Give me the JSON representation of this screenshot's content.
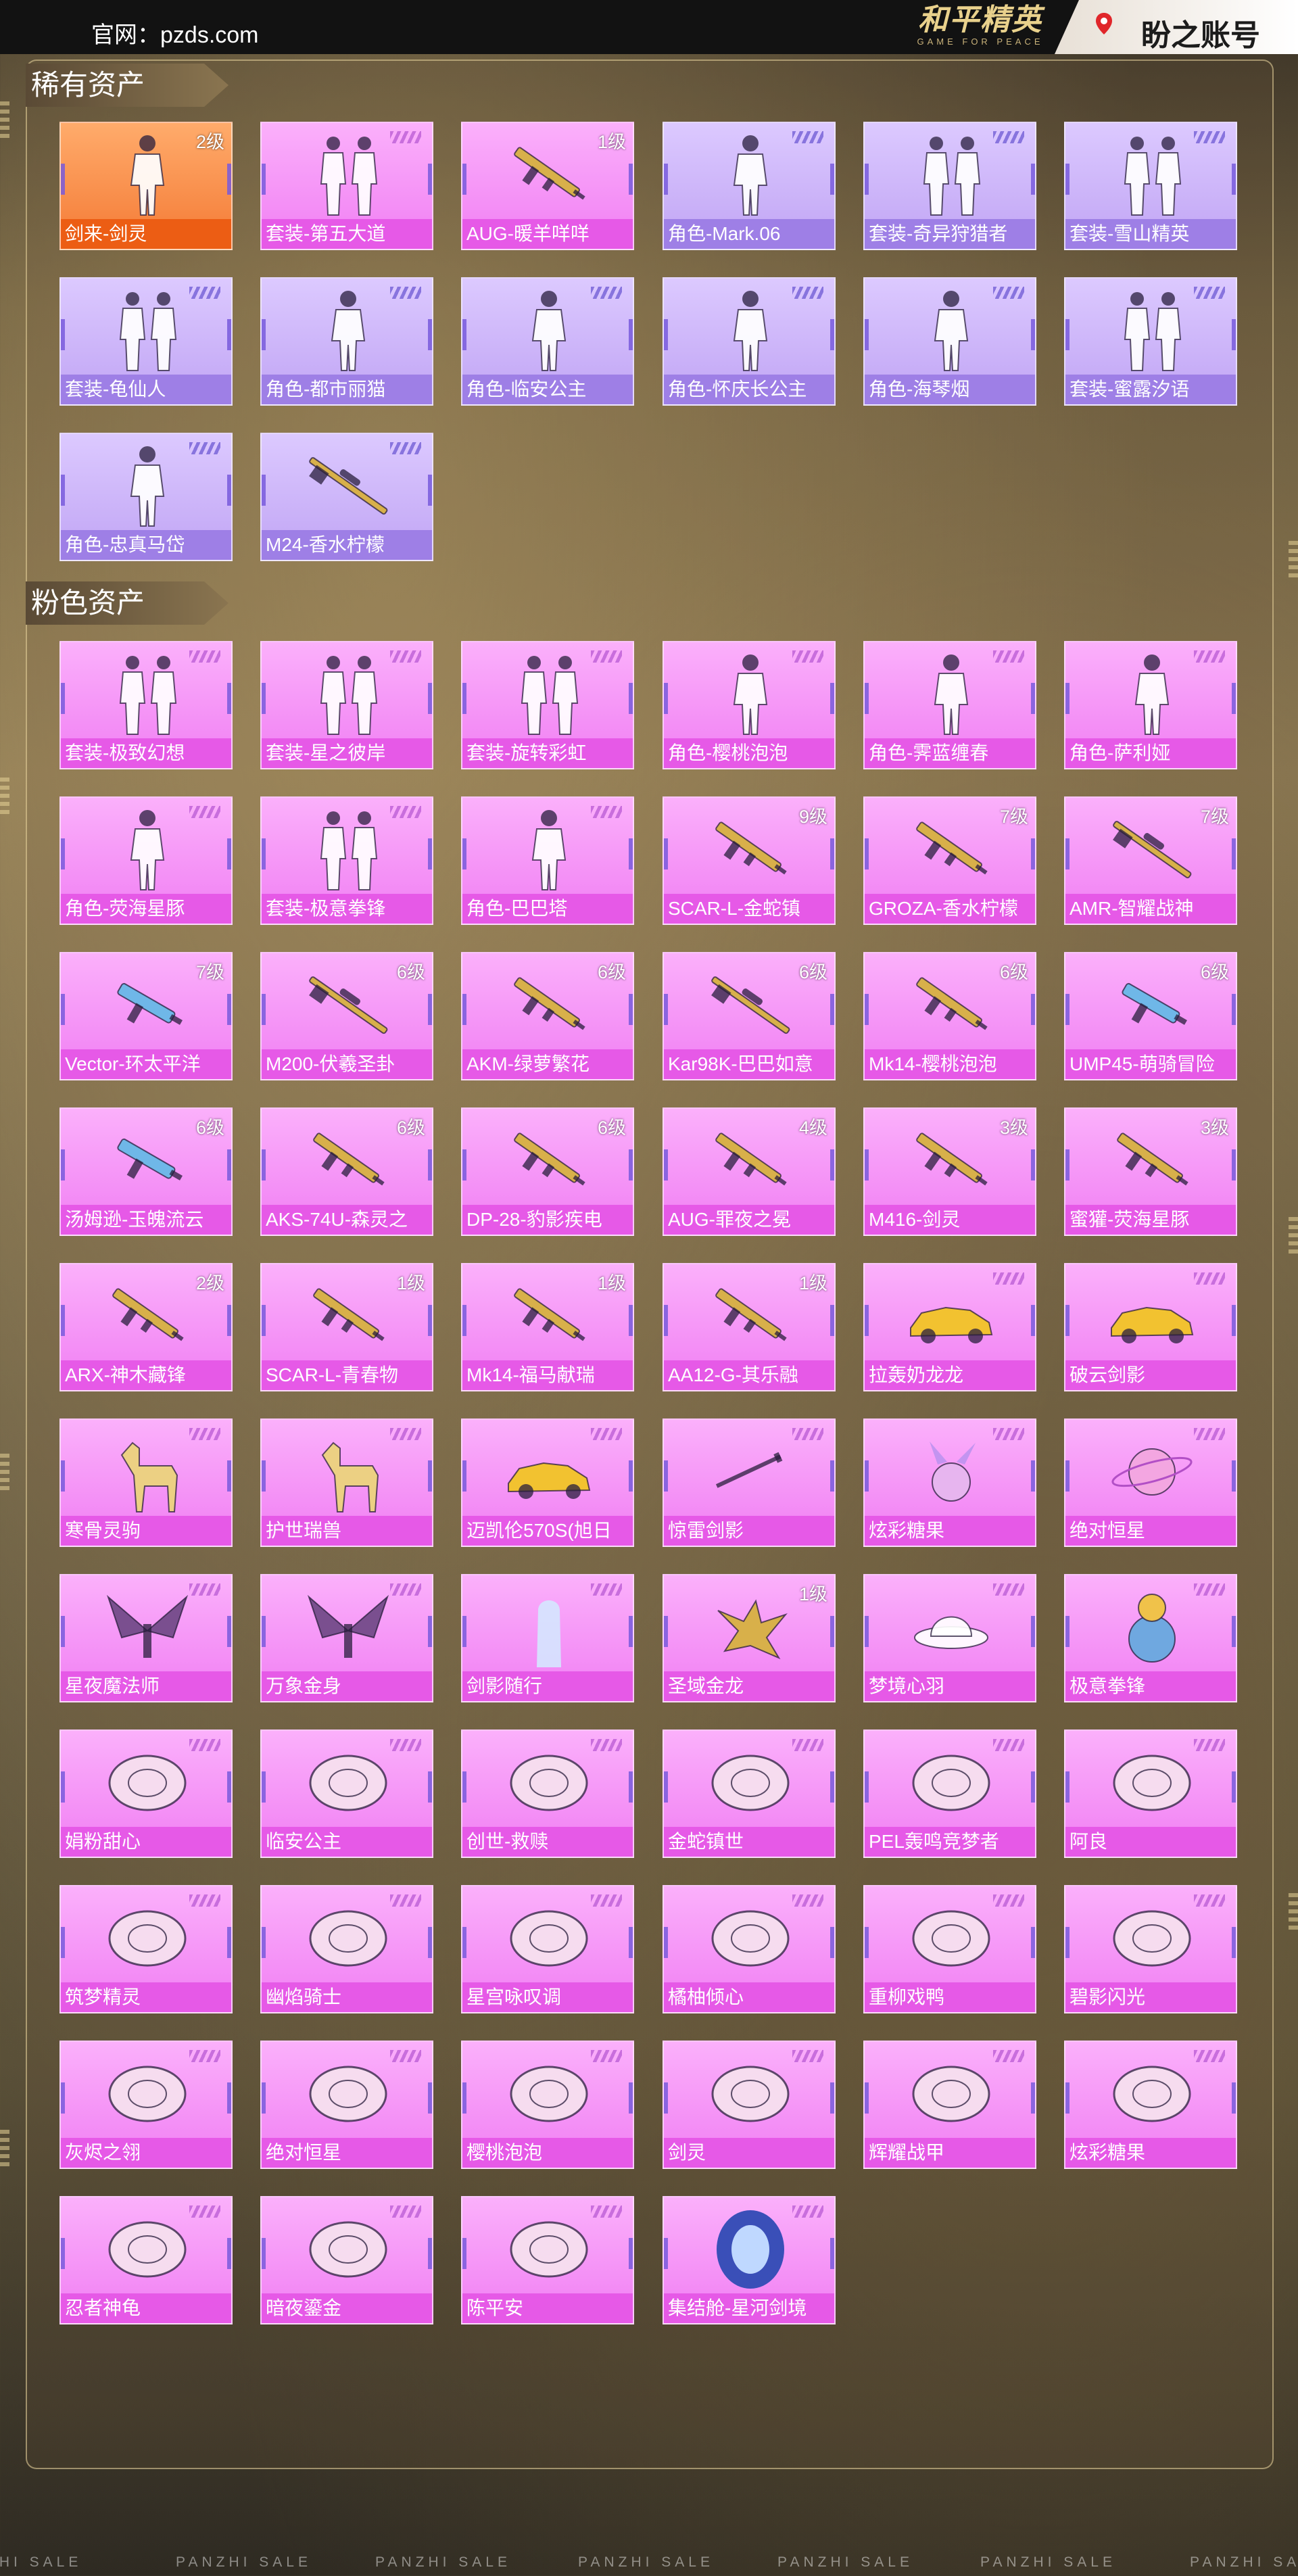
{
  "header": {
    "site_label": "官网：pzds.com",
    "game_logo_title": "和平精英",
    "game_logo_subtitle": "GAME FOR PEACE",
    "brand": "盼之账号"
  },
  "sections": [
    {
      "title": "稀有资产",
      "items": [
        {
          "label": "剑来-剑灵",
          "level": "2级",
          "style": "rare-orange",
          "icon": "character-figure-icon"
        },
        {
          "label": "套装-第五大道",
          "level": "",
          "style": "pink",
          "icon": "outfit-pair-icon"
        },
        {
          "label": "AUG-暖羊咩咩",
          "level": "1级",
          "style": "pink",
          "icon": "rifle-icon"
        },
        {
          "label": "角色-Mark.06",
          "level": "",
          "style": "rare-purple",
          "icon": "character-figure-icon"
        },
        {
          "label": "套装-奇异狩猎者",
          "level": "",
          "style": "rare-purple",
          "icon": "outfit-pair-icon"
        },
        {
          "label": "套装-雪山精英",
          "level": "",
          "style": "rare-purple",
          "icon": "outfit-pair-icon"
        },
        {
          "label": "套装-龟仙人",
          "level": "",
          "style": "rare-purple",
          "icon": "outfit-pair-icon"
        },
        {
          "label": "角色-都市丽猫",
          "level": "",
          "style": "rare-purple",
          "icon": "character-figure-icon"
        },
        {
          "label": "角色-临安公主",
          "level": "",
          "style": "rare-purple",
          "icon": "character-figure-icon"
        },
        {
          "label": "角色-怀庆长公主",
          "level": "",
          "style": "rare-purple",
          "icon": "character-figure-icon"
        },
        {
          "label": "角色-海琴烟",
          "level": "",
          "style": "rare-purple",
          "icon": "character-figure-icon"
        },
        {
          "label": "套装-蜜露汐语",
          "level": "",
          "style": "rare-purple",
          "icon": "outfit-pair-icon"
        },
        {
          "label": "角色-忠真马岱",
          "level": "",
          "style": "rare-purple",
          "icon": "character-figure-icon"
        },
        {
          "label": "M24-香水柠檬",
          "level": "",
          "style": "rare-purple",
          "icon": "sniper-rifle-icon"
        }
      ]
    },
    {
      "title": "粉色资产",
      "items": [
        {
          "label": "套装-极致幻想",
          "level": "",
          "style": "pink",
          "icon": "outfit-pair-icon"
        },
        {
          "label": "套装-星之彼岸",
          "level": "",
          "style": "pink",
          "icon": "outfit-pair-icon"
        },
        {
          "label": "套装-旋转彩虹",
          "level": "",
          "style": "pink",
          "icon": "outfit-pair-icon"
        },
        {
          "label": "角色-樱桃泡泡",
          "level": "",
          "style": "pink",
          "icon": "character-figure-icon"
        },
        {
          "label": "角色-霁蓝缠春",
          "level": "",
          "style": "pink",
          "icon": "character-figure-icon"
        },
        {
          "label": "角色-萨利娅",
          "level": "",
          "style": "pink",
          "icon": "character-figure-icon"
        },
        {
          "label": "角色-荧海星豚",
          "level": "",
          "style": "pink",
          "icon": "character-figure-icon"
        },
        {
          "label": "套装-极意拳锋",
          "level": "",
          "style": "pink",
          "icon": "outfit-pair-icon"
        },
        {
          "label": "角色-巴巴塔",
          "level": "",
          "style": "pink",
          "icon": "character-figure-icon"
        },
        {
          "label": "SCAR-L-金蛇镇",
          "level": "9级",
          "style": "pink",
          "icon": "rifle-icon"
        },
        {
          "label": "GROZA-香水柠檬",
          "level": "7级",
          "style": "pink",
          "icon": "rifle-icon"
        },
        {
          "label": "AMR-智耀战神",
          "level": "7级",
          "style": "pink",
          "icon": "sniper-rifle-icon"
        },
        {
          "label": "Vector-环太平洋",
          "level": "7级",
          "style": "pink",
          "icon": "smg-icon"
        },
        {
          "label": "M200-伏羲圣卦",
          "level": "6级",
          "style": "pink",
          "icon": "sniper-rifle-icon"
        },
        {
          "label": "AKM-绿萝繁花",
          "level": "6级",
          "style": "pink",
          "icon": "rifle-icon"
        },
        {
          "label": "Kar98K-巴巴如意",
          "level": "6级",
          "style": "pink",
          "icon": "sniper-rifle-icon"
        },
        {
          "label": "Mk14-樱桃泡泡",
          "level": "6级",
          "style": "pink",
          "icon": "rifle-icon"
        },
        {
          "label": "UMP45-萌骑冒险",
          "level": "6级",
          "style": "pink",
          "icon": "smg-icon"
        },
        {
          "label": "汤姆逊-玉魄流云",
          "level": "6级",
          "style": "pink",
          "icon": "smg-icon"
        },
        {
          "label": "AKS-74U-森灵之",
          "level": "6级",
          "style": "pink",
          "icon": "rifle-icon"
        },
        {
          "label": "DP-28-豹影疾电",
          "level": "6级",
          "style": "pink",
          "icon": "rifle-icon"
        },
        {
          "label": "AUG-罪夜之冕",
          "level": "4级",
          "style": "pink",
          "icon": "rifle-icon"
        },
        {
          "label": "M416-剑灵",
          "level": "3级",
          "style": "pink",
          "icon": "rifle-icon"
        },
        {
          "label": "蜜獾-荧海星豚",
          "level": "3级",
          "style": "pink",
          "icon": "rifle-icon"
        },
        {
          "label": "ARX-神木藏锋",
          "level": "2级",
          "style": "pink",
          "icon": "rifle-icon"
        },
        {
          "label": "SCAR-L-青春物",
          "level": "1级",
          "style": "pink",
          "icon": "rifle-icon"
        },
        {
          "label": "Mk14-福马献瑞",
          "level": "1级",
          "style": "pink",
          "icon": "rifle-icon"
        },
        {
          "label": "AA12-G-其乐融",
          "level": "1级",
          "style": "pink",
          "icon": "rifle-icon"
        },
        {
          "label": "拉轰奶龙龙",
          "level": "",
          "style": "pink",
          "icon": "car-icon"
        },
        {
          "label": "破云剑影",
          "level": "",
          "style": "pink",
          "icon": "car-icon"
        },
        {
          "label": "寒骨灵驹",
          "level": "",
          "style": "pink",
          "icon": "horse-icon"
        },
        {
          "label": "护世瑞兽",
          "level": "",
          "style": "pink",
          "icon": "horse-icon"
        },
        {
          "label": "迈凯伦570S(旭日",
          "level": "",
          "style": "pink",
          "icon": "car-icon"
        },
        {
          "label": "惊雷剑影",
          "level": "",
          "style": "pink",
          "icon": "sword-icon"
        },
        {
          "label": "炫彩糖果",
          "level": "",
          "style": "pink",
          "icon": "candy-icon"
        },
        {
          "label": "绝对恒星",
          "level": "",
          "style": "pink",
          "icon": "planet-icon"
        },
        {
          "label": "星夜魔法师",
          "level": "",
          "style": "pink",
          "icon": "wings-icon"
        },
        {
          "label": "万象金身",
          "level": "",
          "style": "pink",
          "icon": "wings-icon"
        },
        {
          "label": "剑影随行",
          "level": "",
          "style": "pink",
          "icon": "ghost-icon"
        },
        {
          "label": "圣域金龙",
          "level": "1级",
          "style": "pink",
          "icon": "dragon-icon"
        },
        {
          "label": "梦境心羽",
          "level": "",
          "style": "pink",
          "icon": "hat-icon"
        },
        {
          "label": "极意拳锋",
          "level": "",
          "style": "pink",
          "icon": "pet-icon"
        },
        {
          "label": "娟粉甜心",
          "level": "",
          "style": "pink",
          "icon": "parachute-icon"
        },
        {
          "label": "临安公主",
          "level": "",
          "style": "pink",
          "icon": "parachute-icon"
        },
        {
          "label": "创世-救赎",
          "level": "",
          "style": "pink",
          "icon": "parachute-icon"
        },
        {
          "label": "金蛇镇世",
          "level": "",
          "style": "pink",
          "icon": "parachute-icon"
        },
        {
          "label": "PEL轰鸣竞梦者",
          "level": "",
          "style": "pink",
          "icon": "parachute-icon"
        },
        {
          "label": "阿良",
          "level": "",
          "style": "pink",
          "icon": "parachute-icon"
        },
        {
          "label": "筑梦精灵",
          "level": "",
          "style": "pink",
          "icon": "parachute-icon"
        },
        {
          "label": "幽焰骑士",
          "level": "",
          "style": "pink",
          "icon": "parachute-icon"
        },
        {
          "label": "星宫咏叹调",
          "level": "",
          "style": "pink",
          "icon": "parachute-icon"
        },
        {
          "label": "橘柚倾心",
          "level": "",
          "style": "pink",
          "icon": "parachute-icon"
        },
        {
          "label": "重柳戏鸭",
          "level": "",
          "style": "pink",
          "icon": "parachute-icon"
        },
        {
          "label": "碧影闪光",
          "level": "",
          "style": "pink",
          "icon": "parachute-icon"
        },
        {
          "label": "灰烬之翎",
          "level": "",
          "style": "pink",
          "icon": "parachute-icon"
        },
        {
          "label": "绝对恒星",
          "level": "",
          "style": "pink",
          "icon": "parachute-icon"
        },
        {
          "label": "樱桃泡泡",
          "level": "",
          "style": "pink",
          "icon": "parachute-icon"
        },
        {
          "label": "剑灵",
          "level": "",
          "style": "pink",
          "icon": "parachute-icon"
        },
        {
          "label": "辉耀战甲",
          "level": "",
          "style": "pink",
          "icon": "parachute-icon"
        },
        {
          "label": "炫彩糖果",
          "level": "",
          "style": "pink",
          "icon": "parachute-icon"
        },
        {
          "label": "忍者神龟",
          "level": "",
          "style": "pink",
          "icon": "parachute-icon"
        },
        {
          "label": "暗夜鎏金",
          "level": "",
          "style": "pink",
          "icon": "parachute-icon"
        },
        {
          "label": "陈平安",
          "level": "",
          "style": "pink",
          "icon": "parachute-icon"
        },
        {
          "label": "集结舱-星河剑境",
          "level": "",
          "style": "pink",
          "icon": "pod-icon"
        }
      ]
    }
  ],
  "footer": {
    "watermark_texts": [
      "ZHI SALE",
      "PANZHI SALE",
      "PANZHI SALE",
      "PANZHI SALE",
      "PANZHI SALE",
      "PANZHI SALE",
      "PANZHI SALE"
    ]
  },
  "colors": {
    "rare_orange_label": "#ec5d14",
    "rare_purple_label": "#9e7fe6",
    "pink_label": "#e659e7"
  }
}
